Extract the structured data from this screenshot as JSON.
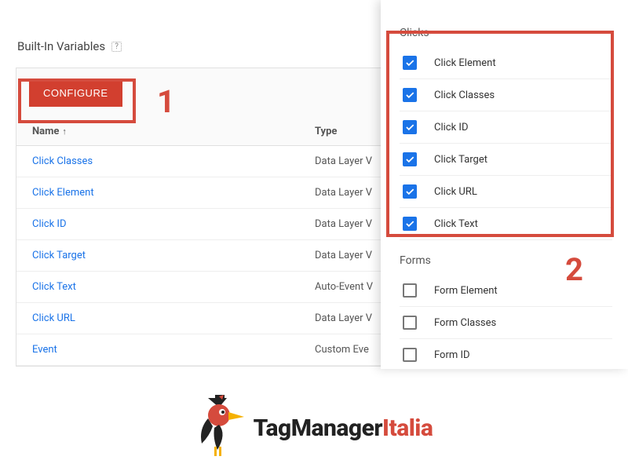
{
  "section": {
    "title": "Built-In Variables"
  },
  "card": {
    "configure_label": "CONFIGURE"
  },
  "callouts": {
    "one": "1",
    "two": "2"
  },
  "table": {
    "headers": {
      "name": "Name",
      "type": "Type"
    },
    "rows": [
      {
        "name": "Click Classes",
        "type": "Data Layer V"
      },
      {
        "name": "Click Element",
        "type": "Data Layer V"
      },
      {
        "name": "Click ID",
        "type": "Data Layer V"
      },
      {
        "name": "Click Target",
        "type": "Data Layer V"
      },
      {
        "name": "Click Text",
        "type": "Auto-Event V"
      },
      {
        "name": "Click URL",
        "type": "Data Layer V"
      },
      {
        "name": "Event",
        "type": "Custom Eve"
      }
    ]
  },
  "panel": {
    "clicks": {
      "title": "Clicks",
      "options": [
        {
          "label": "Click Element",
          "checked": true
        },
        {
          "label": "Click Classes",
          "checked": true
        },
        {
          "label": "Click ID",
          "checked": true
        },
        {
          "label": "Click Target",
          "checked": true
        },
        {
          "label": "Click URL",
          "checked": true
        },
        {
          "label": "Click Text",
          "checked": true
        }
      ]
    },
    "forms": {
      "title": "Forms",
      "options": [
        {
          "label": "Form Element",
          "checked": false
        },
        {
          "label": "Form Classes",
          "checked": false
        },
        {
          "label": "Form ID",
          "checked": false
        }
      ]
    }
  },
  "logo": {
    "text1": "TagManager",
    "text2": "Italia"
  }
}
